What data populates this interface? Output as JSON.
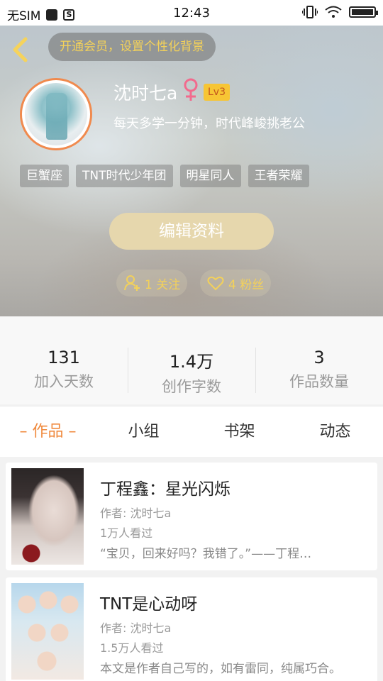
{
  "status_bar": {
    "carrier": "无SIM",
    "time": "12:43"
  },
  "header": {
    "vip_banner": "开通会员，设置个性化背景"
  },
  "profile": {
    "name": "沈时七a",
    "level": "Lv3",
    "motto": "每天多学一分钟，时代峰峻挑老公",
    "tags": [
      "巨蟹座",
      "TNT时代少年团",
      "明星同人",
      "王者荣耀"
    ],
    "edit_button": "编辑资料",
    "follow": "1 关注",
    "fans": "4 粉丝"
  },
  "stats": [
    {
      "value": "131",
      "label": "加入天数"
    },
    {
      "value": "1.4万",
      "label": "创作字数"
    },
    {
      "value": "3",
      "label": "作品数量"
    }
  ],
  "tabs": [
    {
      "label": "– 作品 –",
      "active": true
    },
    {
      "label": "小组",
      "active": false
    },
    {
      "label": "书架",
      "active": false
    },
    {
      "label": "动态",
      "active": false
    }
  ],
  "works": [
    {
      "title": "丁程鑫：星光闪烁",
      "author": "作者: 沈时七a",
      "views": "1万人看过",
      "desc": "“宝贝，回来好吗？我错了。”——丁程…"
    },
    {
      "title": "TNT是心动呀",
      "author": "作者: 沈时七a",
      "views": "1.5万人看过",
      "desc": "本文是作者自己写的，如有雷同，纯属巧合。"
    }
  ],
  "colors": {
    "accent": "#f08a3e",
    "vip_text": "#f3d15a",
    "level_badge": "#f7c534",
    "edit_button": "#e6d7ad"
  }
}
